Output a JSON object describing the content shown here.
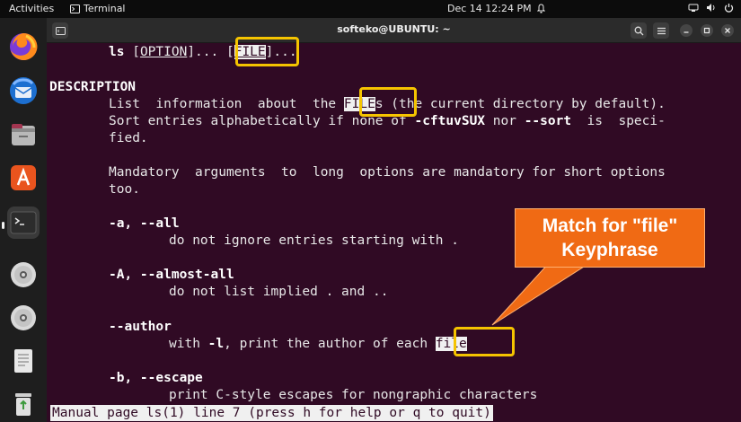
{
  "topbar": {
    "activities": "Activities",
    "app_name": "Terminal",
    "datetime": "Dec 14  12:24 PM"
  },
  "window": {
    "title": "softeko@UBUNTU: ~"
  },
  "terminal": {
    "synopsis": {
      "cmd": "ls",
      "option": "OPTION",
      "file": "FILE"
    },
    "description_heading": "DESCRIPTION",
    "desc_line1_pre": "List  information  about  the ",
    "desc_line1_match": "FILE",
    "desc_line1_post": "s (the current directory by default).",
    "desc_line2_pre": "Sort entries alphabetically if none of ",
    "desc_line2_flag1": "-cftuvSUX",
    "desc_line2_mid": " nor ",
    "desc_line2_flag2": "--sort",
    "desc_line2_post": "  is  speci-",
    "desc_line3": "fied.",
    "mandatory_line1": "Mandatory  arguments  to  long  options are mandatory for short options",
    "mandatory_line2": "too.",
    "opt_all": "-a, --all",
    "opt_all_desc": "do not ignore entries starting with .",
    "opt_almost_all": "-A, --almost-all",
    "opt_almost_all_desc": "do not list implied . and ..",
    "opt_author": "--author",
    "opt_author_desc_pre": "with ",
    "opt_author_flag": "-l",
    "opt_author_desc_post": ", print the author of each ",
    "opt_author_match": "file",
    "opt_escape": "-b, --escape",
    "opt_escape_desc": "print C-style escapes for nongraphic characters",
    "status": "Manual page ls(1) line 7 (press h for help or q to quit)"
  },
  "callout": {
    "line1": "Match for \"file\"",
    "line2": "Keyphrase"
  },
  "colors": {
    "terminal_bg": "#300a24",
    "highlight_border": "#f5c400",
    "callout_fill": "#f06a14"
  },
  "dock": {
    "icons": [
      "firefox-icon",
      "thunderbird-icon",
      "files-icon",
      "app-center-icon",
      "terminal-icon",
      "disc-icon",
      "disc-icon",
      "text-editor-icon",
      "trash-icon"
    ]
  }
}
